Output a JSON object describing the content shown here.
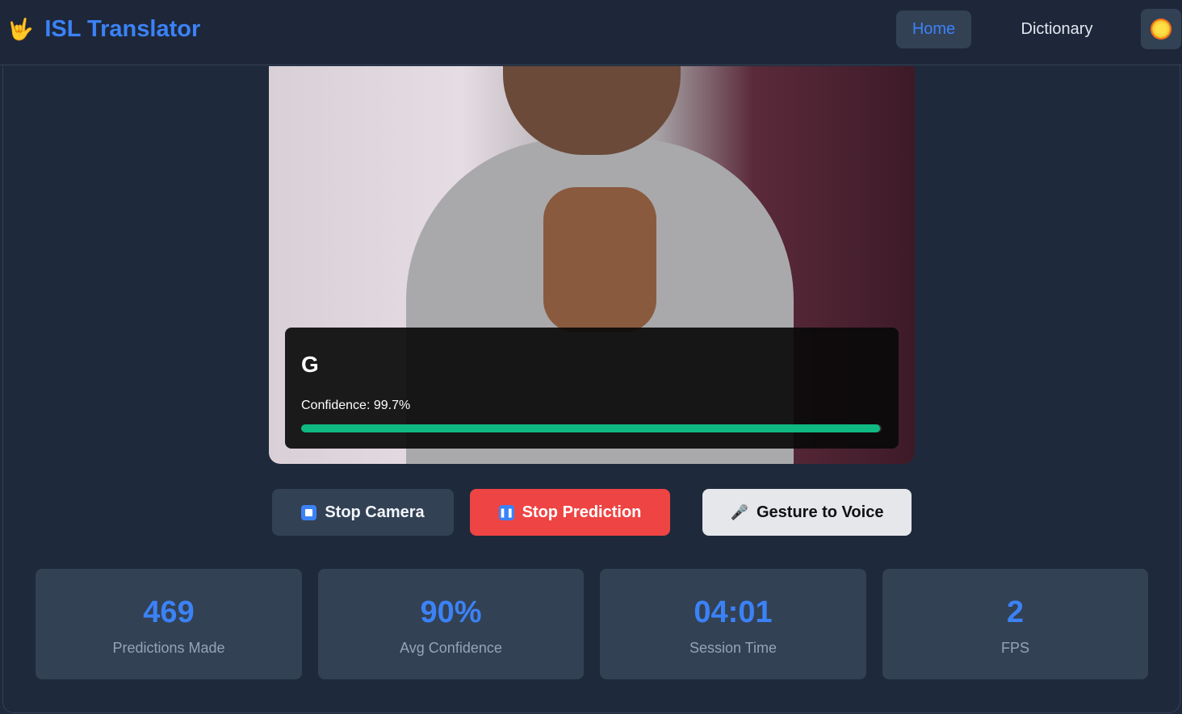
{
  "header": {
    "logo_icon": "🤟",
    "title": "ISL Translator",
    "nav": [
      "Home",
      "Dictionary"
    ],
    "active_nav": "Home",
    "theme_icon": "sun-icon"
  },
  "prediction": {
    "letter": "G",
    "confidence_label": "Confidence: 99.7%",
    "confidence": 99.7
  },
  "buttons": {
    "stop_camera": "Stop Camera",
    "stop_prediction": "Stop Prediction",
    "gesture_to_voice": "Gesture to Voice",
    "mic_icon": "🎤"
  },
  "stats": [
    {
      "value": "469",
      "label": "Predictions Made"
    },
    {
      "value": "90%",
      "label": "Avg Confidence"
    },
    {
      "value": "04:01",
      "label": "Session Time"
    },
    {
      "value": "2",
      "label": "FPS"
    }
  ],
  "colors": {
    "accent": "#3b82f6",
    "danger": "#ef4444",
    "success": "#10b981"
  }
}
